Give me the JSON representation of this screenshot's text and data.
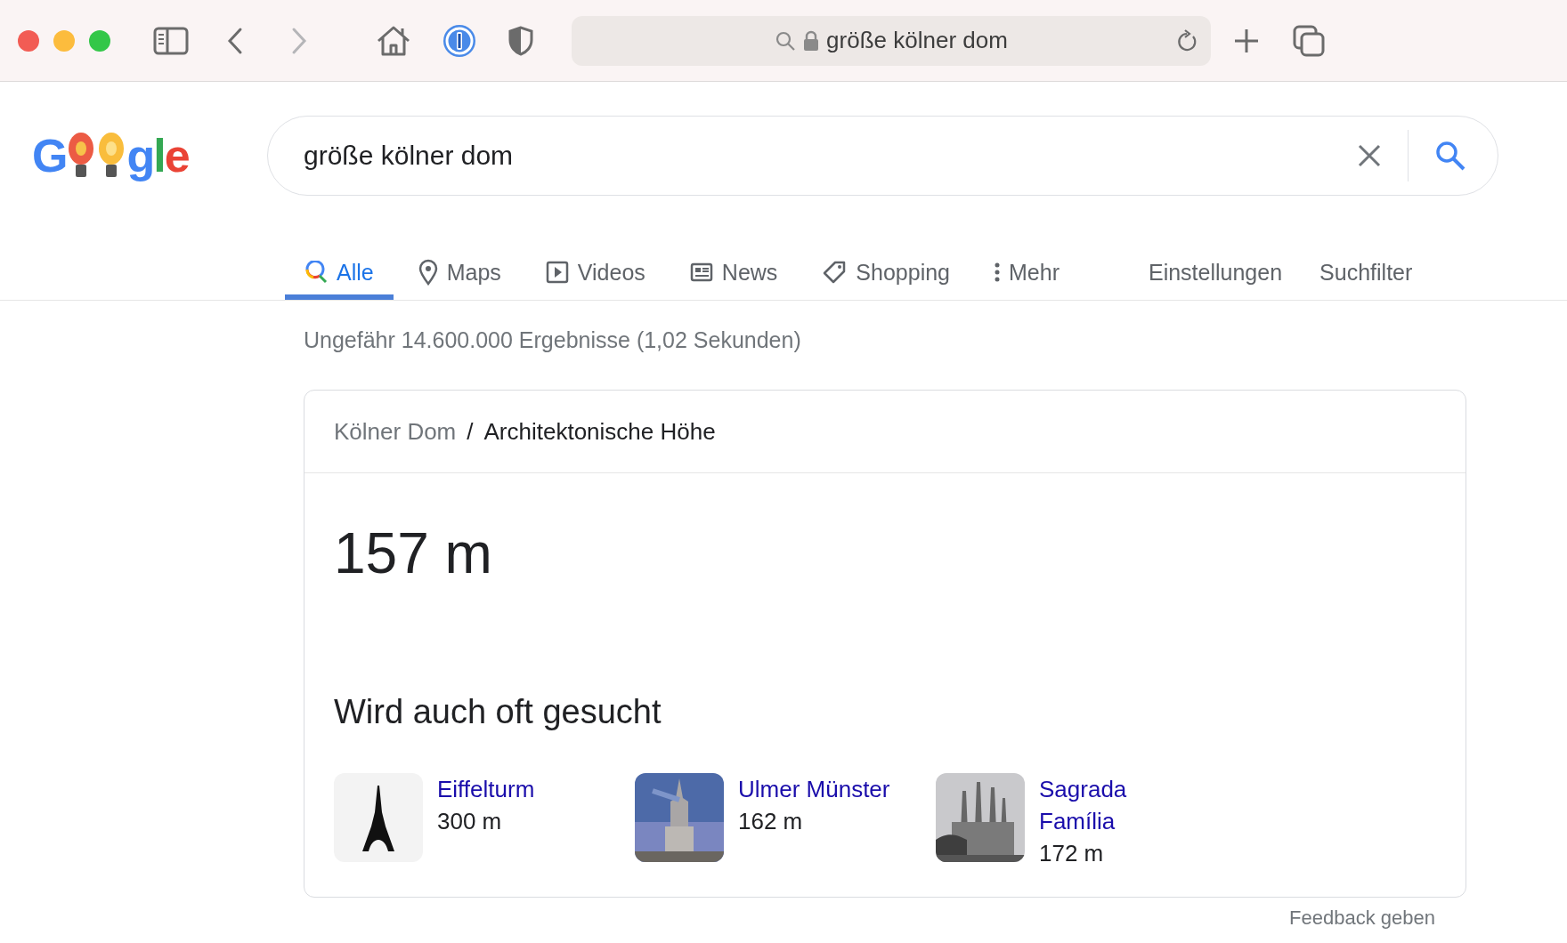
{
  "browser": {
    "address": "größe kölner dom"
  },
  "logo": {
    "lead": "G",
    "tail": "gle"
  },
  "search": {
    "value": "größe kölner dom"
  },
  "tabs": [
    {
      "label": "Alle",
      "kind": "search",
      "selected": true
    },
    {
      "label": "Maps",
      "kind": "pin",
      "selected": false
    },
    {
      "label": "Videos",
      "kind": "play",
      "selected": false
    },
    {
      "label": "News",
      "kind": "news",
      "selected": false
    },
    {
      "label": "Shopping",
      "kind": "tag",
      "selected": false
    },
    {
      "label": "Mehr",
      "kind": "dots",
      "selected": false
    }
  ],
  "tools": [
    "Einstellungen",
    "Suchfilter"
  ],
  "result_count": "Ungefähr 14.600.000 Ergebnisse (1,02 Sekunden)",
  "answer": {
    "breadcrumb": "Kölner Dom",
    "separator": "/",
    "attribute": "Architektonische Höhe",
    "value": "157 m"
  },
  "related": {
    "title": "Wird auch oft gesucht",
    "items": [
      {
        "name": "Eiffelturm",
        "value": "300 m",
        "kind": "tower"
      },
      {
        "name": "Ulmer Münster",
        "value": "162 m",
        "kind": "spire"
      },
      {
        "name": "Sagrada Família",
        "value": "172 m",
        "kind": "basilica"
      }
    ]
  },
  "feedback": "Feedback geben"
}
